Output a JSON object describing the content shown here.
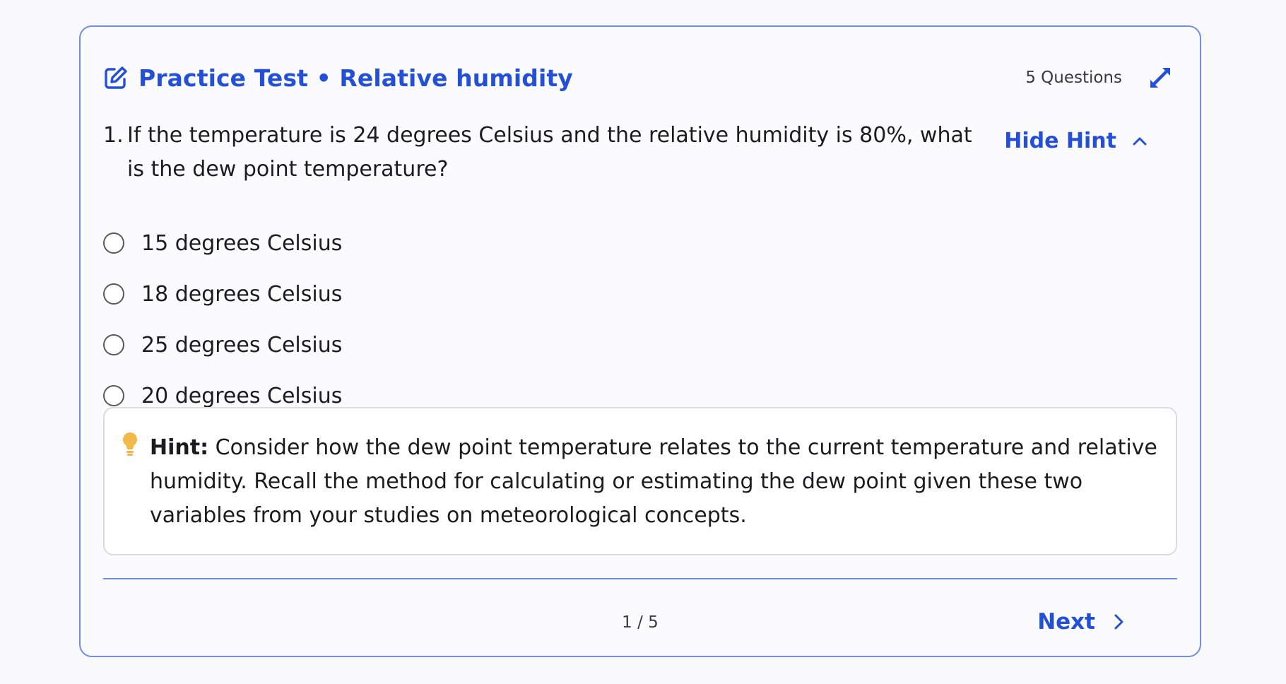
{
  "header": {
    "title": "Practice Test • Relative humidity",
    "question_count": "5 Questions",
    "icons": {
      "title": "edit-icon",
      "expand": "expand-icon"
    }
  },
  "question": {
    "number": "1.",
    "text": "If the temperature is 24 degrees Celsius and the relative humidity is 80%, what is the dew point temperature?",
    "hint_toggle_label": "Hide Hint",
    "options": [
      {
        "label": "15 degrees Celsius"
      },
      {
        "label": "18 degrees Celsius"
      },
      {
        "label": "25 degrees Celsius"
      },
      {
        "label": "20 degrees Celsius"
      }
    ]
  },
  "hint": {
    "label": "Hint:",
    "text": "Consider how the dew point temperature relates to the current temperature and relative humidity. Recall the method for calculating or estimating the dew point given these two variables from your studies on meteorological concepts.",
    "icon": "lightbulb-icon"
  },
  "footer": {
    "page_indicator": "1 / 5",
    "next_label": "Next"
  },
  "colors": {
    "accent": "#2350d6",
    "border": "#6f8fe6",
    "bulb": "#f0b94a"
  }
}
